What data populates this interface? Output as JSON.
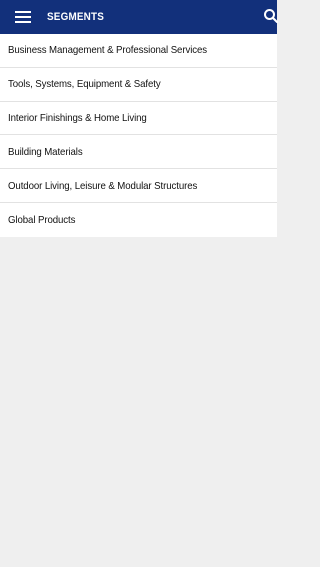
{
  "header": {
    "title": "SEGMENTS",
    "menu_icon": "hamburger-menu-icon",
    "search_icon": "search-icon"
  },
  "segments": [
    {
      "label": "Business Management & Professional Services"
    },
    {
      "label": "Tools, Systems, Equipment & Safety"
    },
    {
      "label": "Interior Finishings & Home Living"
    },
    {
      "label": "Building Materials"
    },
    {
      "label": "Outdoor Living, Leisure & Modular Structures"
    },
    {
      "label": "Global Products"
    }
  ],
  "colors": {
    "header_bg": "#12307b",
    "list_bg": "#ffffff",
    "page_bg": "#efefef",
    "divider": "#e2e2e2"
  }
}
